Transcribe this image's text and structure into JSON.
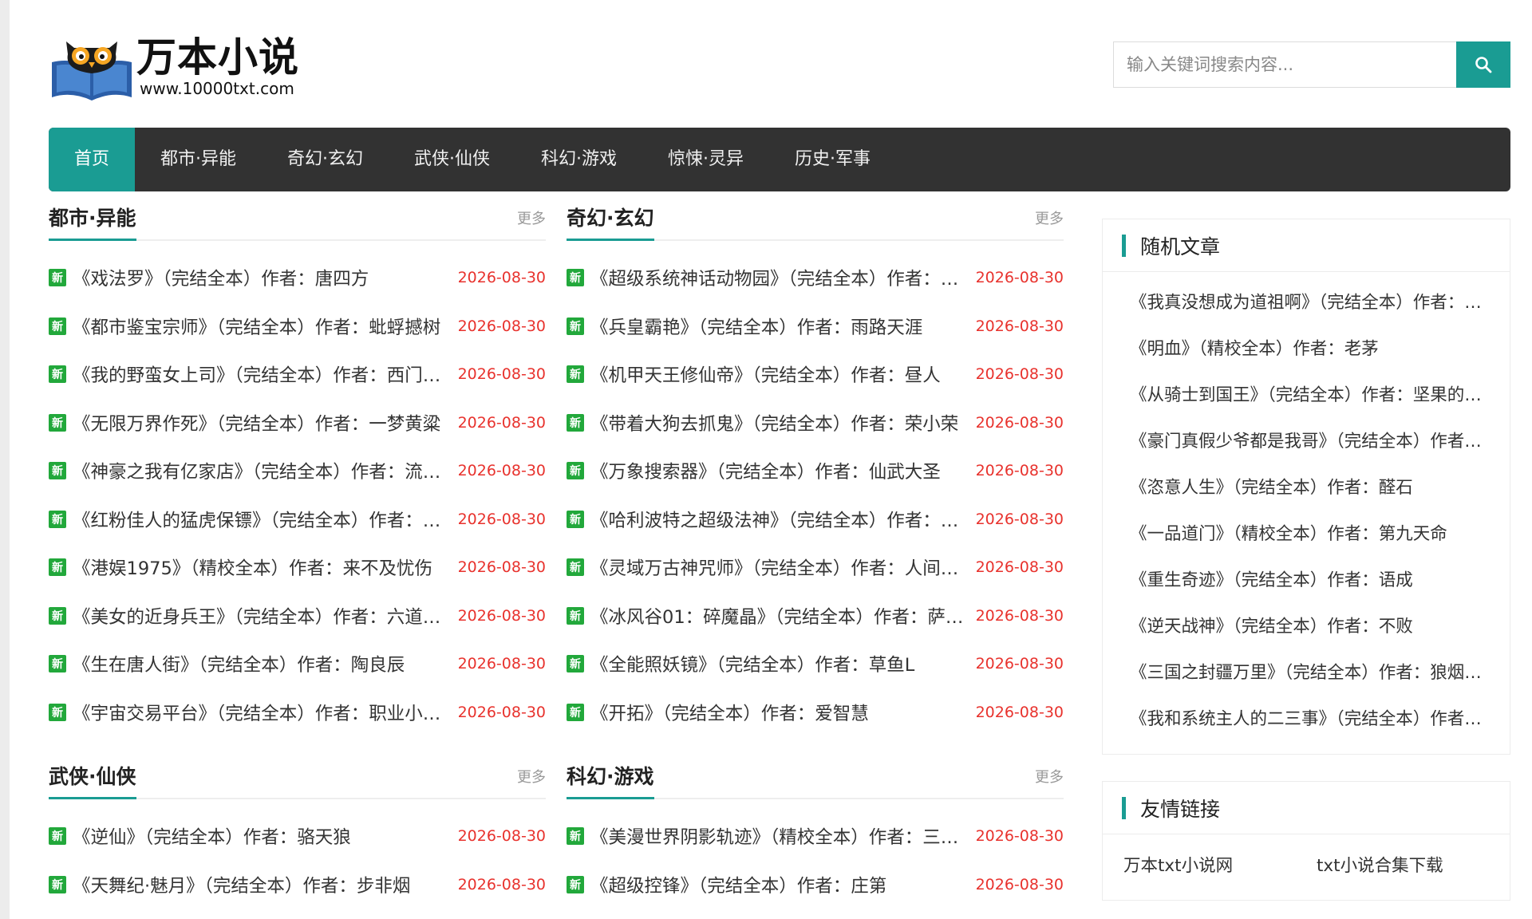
{
  "logo": {
    "name": "万本小说",
    "url": "www.10000txt.com"
  },
  "search": {
    "placeholder": "输入关键词搜索内容..."
  },
  "icons": {
    "search": "search-icon",
    "new_badge": "新"
  },
  "colors": {
    "accent": "#1a9c93",
    "nav_bg": "#323232",
    "date": "#e8322d",
    "badge": "#22a83b"
  },
  "nav": [
    "首页",
    "都市·异能",
    "奇幻·玄幻",
    "武侠·仙侠",
    "科幻·游戏",
    "惊悚·灵异",
    "历史·军事"
  ],
  "sections": [
    {
      "title": "都市·异能",
      "more": "更多",
      "items": [
        {
          "title": "《戏法罗》（完结全本）作者：唐四方",
          "date": "2026-08-30"
        },
        {
          "title": "《都市鉴宝宗师》（完结全本）作者：蚍蜉撼树",
          "date": "2026-08-30"
        },
        {
          "title": "《我的野蛮女上司》（完结全本）作者：西门吹雪",
          "date": "2026-08-30"
        },
        {
          "title": "《无限万界作死》（完结全本）作者：一梦黄粱",
          "date": "2026-08-30"
        },
        {
          "title": "《神豪之我有亿家店》（完结全本）作者：流浪的蛤蟆",
          "date": "2026-08-30"
        },
        {
          "title": "《红粉佳人的猛虎保镖》（完结全本）作者：一叶知秋",
          "date": "2026-08-30"
        },
        {
          "title": "《港娱1975》（精校全本）作者：来不及忧伤",
          "date": "2026-08-30"
        },
        {
          "title": "《美女的近身兵王》（完结全本）作者：六道沉沦",
          "date": "2026-08-30"
        },
        {
          "title": "《生在唐人街》（完结全本）作者：陶良辰",
          "date": "2026-08-30"
        },
        {
          "title": "《宇宙交易平台》（完结全本）作者：职业小说家",
          "date": "2026-08-30"
        }
      ]
    },
    {
      "title": "奇幻·玄幻",
      "more": "更多",
      "items": [
        {
          "title": "《超级系统神话动物园》（完结全本）作者：白衣老祖",
          "date": "2026-08-30"
        },
        {
          "title": "《兵皇霸艳》（完结全本）作者：雨路天涯",
          "date": "2026-08-30"
        },
        {
          "title": "《机甲天王修仙帝》（完结全本）作者：昼人",
          "date": "2026-08-30"
        },
        {
          "title": "《带着大狗去抓鬼》（完结全本）作者：荣小荣",
          "date": "2026-08-30"
        },
        {
          "title": "《万象搜索器》（完结全本）作者：仙武大圣",
          "date": "2026-08-30"
        },
        {
          "title": "《哈利波特之超级法神》（完结全本）作者：王不死",
          "date": "2026-08-30"
        },
        {
          "title": "《灵域万古神咒师》（完结全本）作者：人间正道",
          "date": "2026-08-30"
        },
        {
          "title": "《冰风谷01：碎魔晶》（完结全本）作者：萨尔瓦多",
          "date": "2026-08-30"
        },
        {
          "title": "《全能照妖镜》（完结全本）作者：草鱼L",
          "date": "2026-08-30"
        },
        {
          "title": "《开拓》（完结全本）作者：爱智慧",
          "date": "2026-08-30"
        }
      ]
    },
    {
      "title": "武侠·仙侠",
      "more": "更多",
      "items": [
        {
          "title": "《逆仙》（完结全本）作者：骆天狼",
          "date": "2026-08-30"
        },
        {
          "title": "《天舞纪·魅月》（完结全本）作者：步非烟",
          "date": "2026-08-30"
        }
      ]
    },
    {
      "title": "科幻·游戏",
      "more": "更多",
      "items": [
        {
          "title": "《美漫世界阴影轨迹》（精校全本）作者：三三得九",
          "date": "2026-08-30"
        },
        {
          "title": "《超级控锋》（完结全本）作者：庄第",
          "date": "2026-08-30"
        }
      ]
    }
  ],
  "random": {
    "title": "随机文章",
    "items": [
      "《我真没想成为道祖啊》（完结全本）作者：落日余晖",
      "《明血》（精校全本）作者：老茅",
      "《从骑士到国王》（完结全本）作者：坚果的风暴",
      "《豪门真假少爷都是我哥》（完结全本）作者：林小七",
      "《恣意人生》（完结全本）作者：醛石",
      "《一品道门》（精校全本）作者：第九天命",
      "《重生奇迹》（完结全本）作者：语成",
      "《逆天战神》（完结全本）作者：不败",
      "《三国之封疆万里》（完结全本）作者：狼烟起处",
      "《我和系统主人的二三事》（完结全本）作者：青梅煮酒"
    ]
  },
  "friends": {
    "title": "友情链接",
    "items": [
      "万本txt小说网",
      "txt小说合集下载"
    ]
  }
}
